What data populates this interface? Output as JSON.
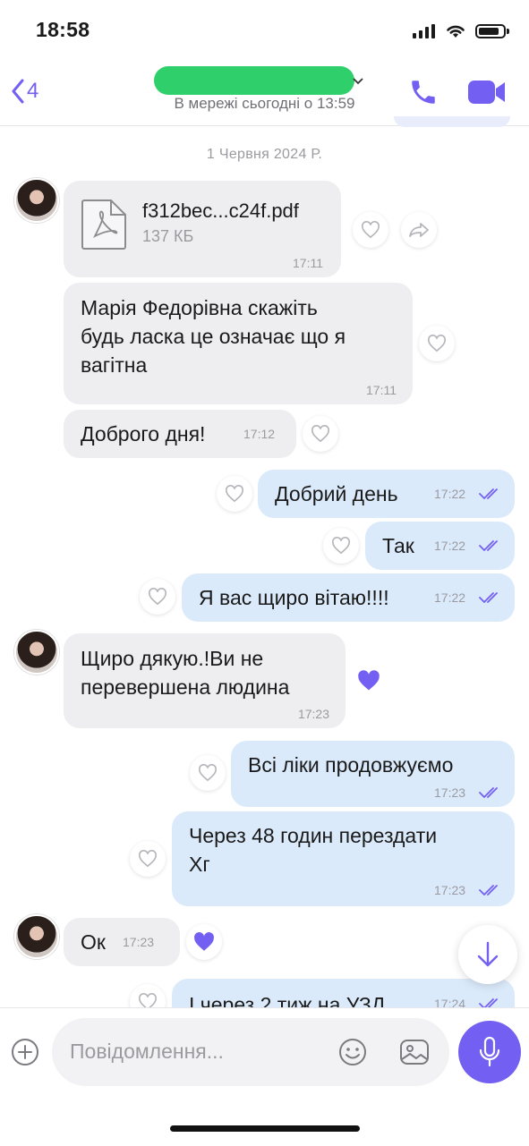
{
  "status": {
    "time": "18:58"
  },
  "header": {
    "back_count": "4",
    "online_status": "В мережі сьогодні о 13:59"
  },
  "date_separator": "1 Червня 2024 Р.",
  "messages": [
    {
      "type": "file",
      "file_name": "f312bec...c24f.pdf",
      "file_size": "137 КБ",
      "time": "17:11"
    },
    {
      "text_lines": [
        "Марія Федорівна скажіть",
        "будь ласка це означає що я",
        "вагітна"
      ],
      "time": "17:11"
    },
    {
      "text": "Доброго дня!",
      "time": "17:12"
    },
    {
      "text": "Добрий день",
      "time": "17:22"
    },
    {
      "text": "Так",
      "time": "17:22"
    },
    {
      "text": "Я вас щиро вітаю!!!!",
      "time": "17:22"
    },
    {
      "text_lines": [
        "Щиро дякую.!Ви не",
        "перевершена людина"
      ],
      "time": "17:23"
    },
    {
      "text": "Всі ліки продовжуємо",
      "time": "17:23"
    },
    {
      "text_lines": [
        "Через 48 годин перездати",
        "Хг"
      ],
      "time": "17:23"
    },
    {
      "text": "Ок",
      "time": "17:23"
    },
    {
      "text": "І через 2 тиж на УЗД",
      "time": "17:24"
    }
  ],
  "composer": {
    "placeholder": "Повідомлення..."
  },
  "colors": {
    "accent": "#7360f2",
    "outgoing_bubble": "#dbeafb",
    "incoming_bubble": "#eeeef0",
    "name_redaction": "#2fd06b"
  }
}
